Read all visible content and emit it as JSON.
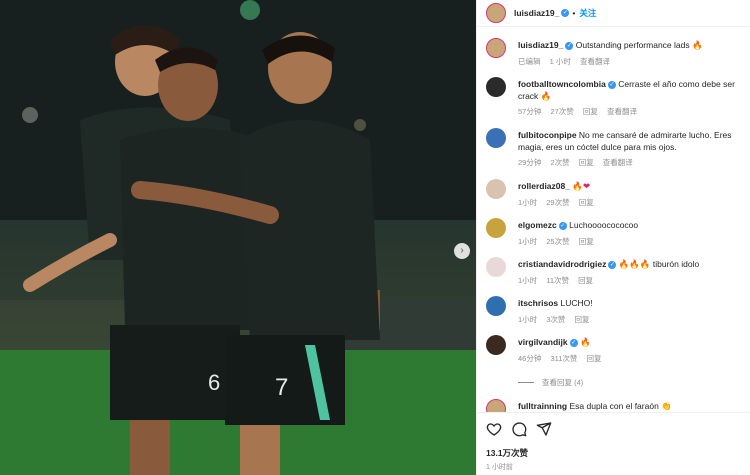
{
  "post": {
    "username": "luisdiaz19_",
    "follow_label": "关注",
    "separator": "•",
    "likes": "13.1万次赞",
    "time": "1 小时前"
  },
  "comments": [
    {
      "user": "luisdiaz19_",
      "verified": true,
      "text": "Outstanding performance lads",
      "emoji": [
        "flame"
      ],
      "edited": "已编辑",
      "age": "1 小时",
      "likes": "",
      "reply": "",
      "translate": "查看翻译"
    },
    {
      "user": "footballtowncolombia",
      "verified": true,
      "text": "Cerraste el año como debe ser crack",
      "emoji": [
        "flame"
      ],
      "edited": "",
      "age": "57分钟",
      "likes": "27次赞",
      "reply": "回复",
      "translate": "查看翻译"
    },
    {
      "user": "fulbitoconpipe",
      "verified": false,
      "text": "No me cansaré de admirarte lucho. Eres magia, eres un cóctel dulce para mis ojos.",
      "emoji": [],
      "edited": "",
      "age": "29分钟",
      "likes": "2次赞",
      "reply": "回复",
      "translate": "查看翻译"
    },
    {
      "user": "rollerdiaz08_",
      "verified": false,
      "text": "",
      "emoji": [
        "flame",
        "heart"
      ],
      "edited": "",
      "age": "1小时",
      "likes": "29次赞",
      "reply": "回复",
      "translate": ""
    },
    {
      "user": "elgomezc",
      "verified": true,
      "text": "Luchoooocococoo",
      "emoji": [],
      "edited": "",
      "age": "1小时",
      "likes": "25次赞",
      "reply": "回复",
      "translate": ""
    },
    {
      "user": "cristiandavidrodrigiez",
      "verified": true,
      "text": "tiburón  idolo",
      "emoji": [
        "flame",
        "flame",
        "flame"
      ],
      "edited": "",
      "age": "1小时",
      "likes": "11次赞",
      "reply": "回复",
      "translate": ""
    },
    {
      "user": "itschrisos",
      "verified": false,
      "text": "LUCHO!",
      "emoji": [],
      "edited": "",
      "age": "1小时",
      "likes": "3次赞",
      "reply": "回复",
      "translate": ""
    },
    {
      "user": "virgilvandijk",
      "verified": true,
      "text": "",
      "emoji": [
        "flame"
      ],
      "edited": "",
      "age": "46分钟",
      "likes": "311次赞",
      "reply": "回复",
      "translate": ""
    },
    {
      "user": "fulltrainning",
      "verified": false,
      "text": "Esa dupla con el faraón",
      "emoji": [
        "clap"
      ],
      "edited": "",
      "age": "",
      "likes": "",
      "reply": "",
      "translate": ""
    }
  ],
  "view_replies": "查看回复 (4)",
  "icons": {
    "like": "heart-outline-icon",
    "comment": "comment-icon",
    "share": "paper-plane-icon",
    "next": "chevron-right-icon"
  },
  "colors": {
    "verified": "#3897f0",
    "follow": "#0095f6",
    "muted": "#8e8e8e",
    "text": "#262626"
  }
}
